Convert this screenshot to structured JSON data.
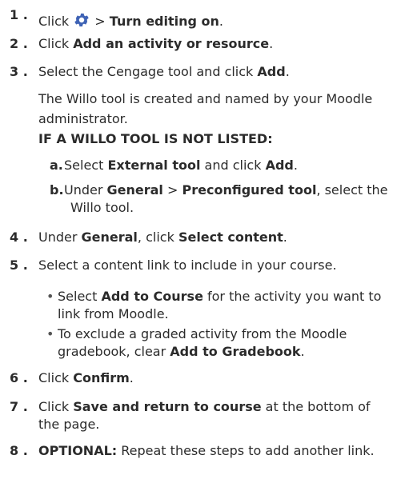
{
  "steps": [
    {
      "num": "1",
      "sep": ".",
      "pre": "Click ",
      "mid": " > ",
      "bold": "Turn editing on",
      "post": "."
    },
    {
      "num": "2",
      "sep": ".",
      "pre": "Click ",
      "bold": "Add an activity or resource",
      "post": "."
    },
    {
      "num": "3",
      "sep": ".",
      "pre": "Select the Cengage tool and click ",
      "bold": "Add",
      "post": "."
    },
    {
      "num": "4",
      "sep": ".",
      "pre": "Under ",
      "bold1": "General",
      "mid": ", click ",
      "bold2": "Select content",
      "post": "."
    },
    {
      "num": "5",
      "sep": ".",
      "text": "Select a content link to include in your course."
    },
    {
      "num": "6",
      "sep": ".",
      "pre": "Click ",
      "bold": "Confirm",
      "post": "."
    },
    {
      "num": "7",
      "sep": ".",
      "pre": "Click ",
      "bold": "Save and return to course",
      "post": " at the bottom of the page."
    },
    {
      "num": "8",
      "sep": ".",
      "bold": "OPTIONAL:",
      "post": " Repeat these steps to add another link."
    }
  ],
  "willo_note": "The Willo tool is created and named by your Moodle administrator.",
  "willo_heading": "IF A WILLO TOOL IS NOT LISTED:",
  "sub_steps": [
    {
      "label": "a.",
      "pre": "Select ",
      "bold": "External tool",
      "mid": " and click ",
      "bold2": "Add",
      "post": "."
    },
    {
      "label": "b.",
      "pre": "Under ",
      "bold": "General",
      "mid": " > ",
      "bold2": "Preconfigured tool",
      "post": ", select the Willo tool."
    }
  ],
  "bullets": [
    {
      "pre": "Select ",
      "bold": "Add to Course",
      "post": " for the activity you want to link from Moodle."
    },
    {
      "pre": "To exclude a graded activity from the Moodle gradebook, clear ",
      "bold": "Add to Gradebook",
      "post": "."
    }
  ],
  "icons": {
    "settings": "gear-icon"
  },
  "colors": {
    "gear": "#3f63b5",
    "text": "#2b2b2b"
  }
}
